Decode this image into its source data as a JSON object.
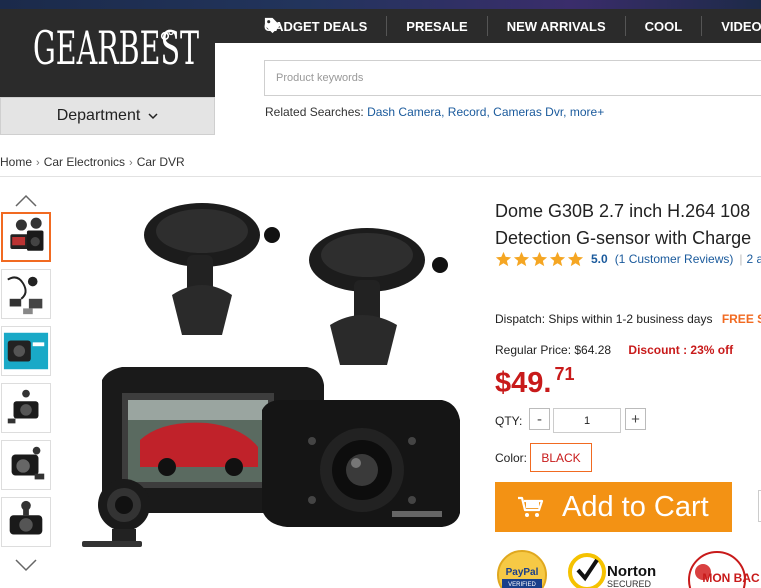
{
  "logo": {
    "text": "GearBest"
  },
  "department": {
    "label": "Department"
  },
  "nav": {
    "items": [
      "GADGET DEALS",
      "PRESALE",
      "NEW ARRIVALS",
      "COOL",
      "VIDEO"
    ]
  },
  "search": {
    "placeholder": "Product keywords"
  },
  "related": {
    "label": "Related Searches:",
    "links": [
      "Dash Camera,",
      "Record,",
      "Cameras Dvr,",
      "more+"
    ]
  },
  "breadcrumb": [
    "Home",
    "Car Electronics",
    "Car DVR"
  ],
  "product": {
    "title_line1": "Dome G30B 2.7 inch H.264 108",
    "title_line2": "Detection G-sensor with Charge",
    "rating_score": "5.0",
    "stars": 5,
    "reviews_link": "(1 Customer Reviews)",
    "extra_link": "2 a",
    "dispatch_label": "Dispatch:",
    "dispatch_value": "Ships within 1-2 business days",
    "free_shipping": "FREE S",
    "regular_label": "Regular Price:",
    "regular_price": "$64.28",
    "discount": "Discount : 23% off",
    "price_main": "$49.",
    "price_cents": "71",
    "qty_label": "QTY:",
    "qty_minus": "-",
    "qty_value": "1",
    "qty_plus": "+",
    "color_label": "Color:",
    "color_value": "BLACK",
    "add_to_cart": "Add to Cart"
  },
  "badges": {
    "paypal_top": "PayPal",
    "paypal_bottom": "VERIFIED",
    "norton_top": "Norton",
    "norton_bottom": "SECURED",
    "money_back": "MON BAC"
  },
  "colors": {
    "accent_orange": "#f39214",
    "price_red": "#c81a1a",
    "link_blue": "#1a5a9c",
    "header_dark": "#2b2b2b",
    "star_gold": "#f5a623"
  }
}
